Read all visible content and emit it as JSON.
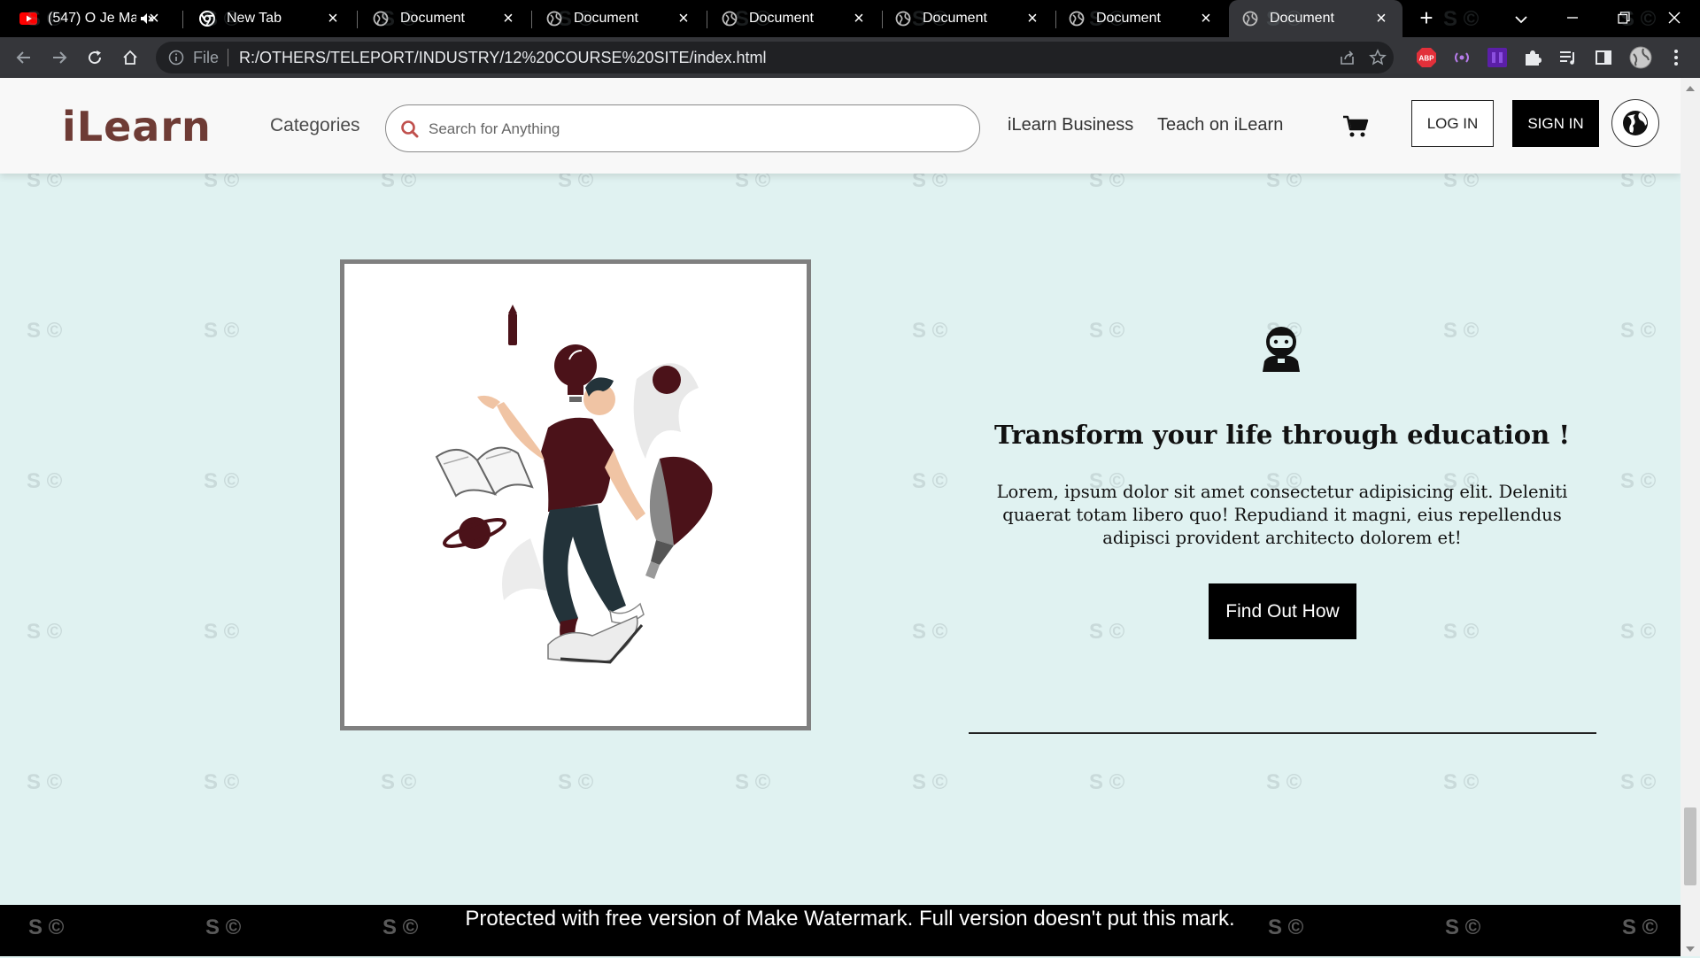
{
  "browser": {
    "tabs": [
      {
        "title": "(547) O Je Ma",
        "favicon": "youtube-icon",
        "active": false,
        "muted": true
      },
      {
        "title": "New Tab",
        "favicon": "chrome-icon",
        "active": false
      },
      {
        "title": "Document",
        "favicon": "globe-icon",
        "active": false
      },
      {
        "title": "Document",
        "favicon": "globe-icon",
        "active": false
      },
      {
        "title": "Document",
        "favicon": "globe-icon",
        "active": false
      },
      {
        "title": "Document",
        "favicon": "globe-icon",
        "active": false
      },
      {
        "title": "Document",
        "favicon": "globe-icon",
        "active": false
      },
      {
        "title": "Document",
        "favicon": "globe-icon",
        "active": true
      }
    ],
    "address": {
      "scheme_label": "File",
      "url": "R:/OTHERS/TELEPORT/INDUSTRY/12%20COURSE%20SITE/index.html"
    },
    "extensions": [
      {
        "name": "adblock-plus-icon",
        "label": "ABP"
      }
    ]
  },
  "site": {
    "logo": "iLearn",
    "nav": {
      "categories": "Categories",
      "search_placeholder": "Search for Anything",
      "business": "iLearn Business",
      "teach": "Teach on iLearn",
      "login": "LOG IN",
      "signin": "SIGN IN"
    },
    "brand_color": "#6e3b35",
    "background_color": "#e0f2f1"
  },
  "content": {
    "illustration": "person-juggling-learning-icons-illustration",
    "icon": "robot-icon",
    "headline": "Transform your life through education !",
    "body": "Lorem, ipsum dolor sit amet consectetur adipisicing elit. Deleniti quaerat totam libero quo! Repudiand it magni, eius repellendus adipisci provident architecto dolorem et!",
    "cta": "Find Out How"
  },
  "watermark": {
    "mark": "S ©",
    "banner": "Protected with free version of Make Watermark. Full version doesn't put this mark."
  }
}
